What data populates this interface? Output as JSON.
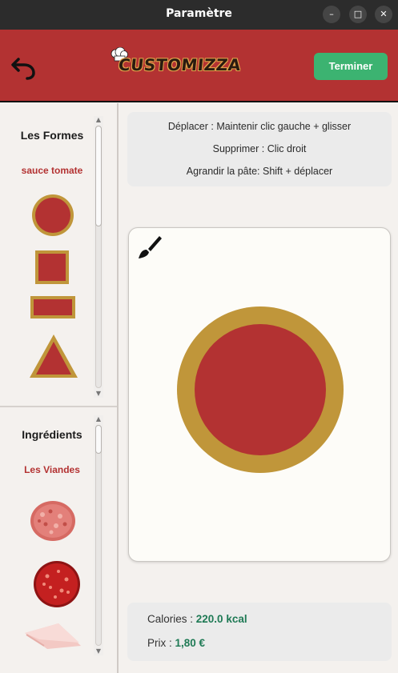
{
  "window": {
    "title": "Paramètre",
    "buttons": {
      "minimize": "–",
      "maximize": "□",
      "close": "✕"
    }
  },
  "header": {
    "logo_text": "CUSTOMIZZA",
    "finish_label": "Terminer",
    "brand_color": "#b33232",
    "finish_color": "#3cb371"
  },
  "sidebar": {
    "shapes": {
      "title": "Les Formes",
      "subtitle": "sauce tomate",
      "items": [
        "circle-shape",
        "square-shape",
        "rectangle-shape",
        "triangle-shape"
      ]
    },
    "ingredients": {
      "title": "Ingrédients",
      "subtitle": "Les Viandes",
      "items": [
        "ground-meat",
        "chorizo",
        "ham"
      ]
    }
  },
  "instructions": {
    "move": "Déplacer : Maintenir clic gauche + glisser",
    "delete": "Supprimer : Clic droit",
    "enlarge": "Agrandir la pâte: Shift + déplacer"
  },
  "canvas": {
    "tool_icon": "brush-icon",
    "pizza_crust_color": "#c0963a",
    "pizza_sauce_color": "#b33232"
  },
  "info": {
    "calories_label": "Calories : ",
    "calories_value": "220.0 kcal",
    "price_label": "Prix : ",
    "price_value": "1,80 €"
  }
}
